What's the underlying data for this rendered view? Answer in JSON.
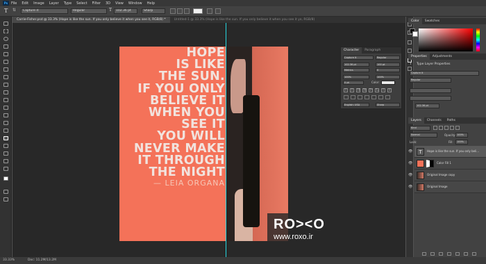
{
  "menu": {
    "items": [
      "File",
      "Edit",
      "Image",
      "Layer",
      "Type",
      "Select",
      "Filter",
      "3D",
      "View",
      "Window",
      "Help"
    ]
  },
  "options": {
    "font_family": "Capture it",
    "font_style": "Regular",
    "font_size": "102.36 pt",
    "antialias": "Sharp"
  },
  "tabs": [
    {
      "label": "Carrie-Fisher.psd @ 33.3% (Hope is like  the sun.  If you only  believe it  when you see it, RGB/8) *"
    },
    {
      "label": "Untitled-1 @ 33.3% (Hope is like  the sun.  If you only  believe it  when you see it yo, RGB/8)"
    }
  ],
  "quote": {
    "lines": [
      "HOPE",
      "IS LIKE",
      "THE SUN.",
      "IF YOU ONLY",
      "BELIEVE IT",
      "WHEN YOU",
      "SEE IT",
      "YOU WILL",
      "NEVER MAKE",
      "IT THROUGH",
      "THE NIGHT"
    ],
    "signature": "— LEIA ORGANA"
  },
  "watermark": {
    "logo": "RO><O",
    "url": "www.roxo.ir"
  },
  "status": {
    "zoom": "33.33%",
    "doc": "Doc: 11.2M/13.2M"
  },
  "character_panel": {
    "tab_character": "Character",
    "tab_paragraph": "Paragraph",
    "font": "Capture it",
    "style": "Regular",
    "size": "102.36 pt",
    "leading": "100 pt",
    "kerning": "Metrics",
    "tracking": "0",
    "vscale": "100%",
    "hscale": "100%",
    "baseline": "0 pt",
    "color_label": "Color:",
    "language": "English: USA",
    "antialias": "Sharp",
    "styles": [
      "T",
      "T",
      "TT",
      "Tt",
      "T¹",
      "T₁",
      "T",
      "Ŧ"
    ]
  },
  "color_panel": {
    "tab_color": "Color",
    "tab_swatches": "Swatches"
  },
  "properties_panel": {
    "tab_properties": "Properties",
    "tab_adjustments": "Adjustments",
    "title": "Type Layer Properties",
    "font": "Capture it",
    "style": "Regular",
    "size": "102.36 pt"
  },
  "layers_panel": {
    "tab_layers": "Layers",
    "tab_channels": "Channels",
    "tab_paths": "Paths",
    "kind": "Kind",
    "blend": "Normal",
    "opacity_label": "Opacity:",
    "opacity": "100%",
    "lock_label": "Lock:",
    "fill_label": "Fill:",
    "fill": "100%",
    "layers": [
      {
        "name": "Hope is like  the sun.  If you only  beli...",
        "type": "text",
        "selected": true
      },
      {
        "name": "Color Fill 1",
        "type": "fill"
      },
      {
        "name": "Original Image copy",
        "type": "image"
      },
      {
        "name": "Original Image",
        "type": "image"
      }
    ]
  }
}
